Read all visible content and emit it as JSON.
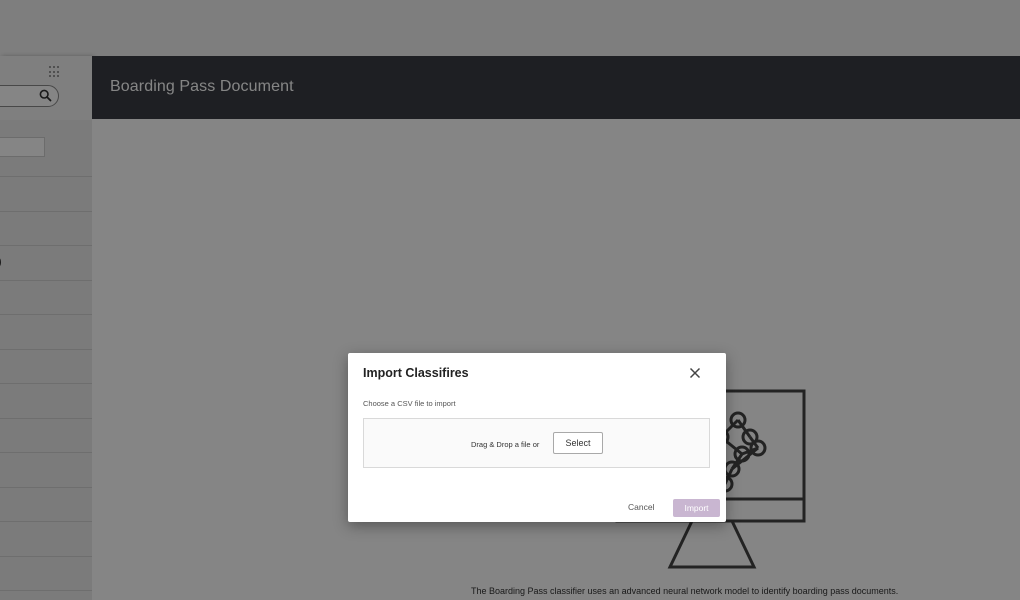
{
  "header": {
    "title": "Boarding Pass Document"
  },
  "sidebar": {
    "row_fragments": [
      "",
      "",
      ")",
      "",
      "",
      "",
      "",
      "",
      "",
      "",
      "",
      "",
      ""
    ]
  },
  "main": {
    "description": "The Boarding Pass classifier uses an advanced neural network model to identify boarding pass documents."
  },
  "modal": {
    "title": "Import Classifires",
    "subtitle": "Choose a CSV file to import",
    "dropzone_text": "Drag & Drop a file or",
    "select_label": "Select",
    "cancel_label": "Cancel",
    "import_label": "Import"
  },
  "icons": {
    "search": "search-icon",
    "close": "close-icon",
    "apps": "grid-icon",
    "illustration": "monitor-neural-network-icon"
  },
  "colors": {
    "header_bg": "#3a3d44",
    "import_disabled": "#c9b6d1",
    "backdrop": "rgba(0,0,0,0.48)"
  }
}
